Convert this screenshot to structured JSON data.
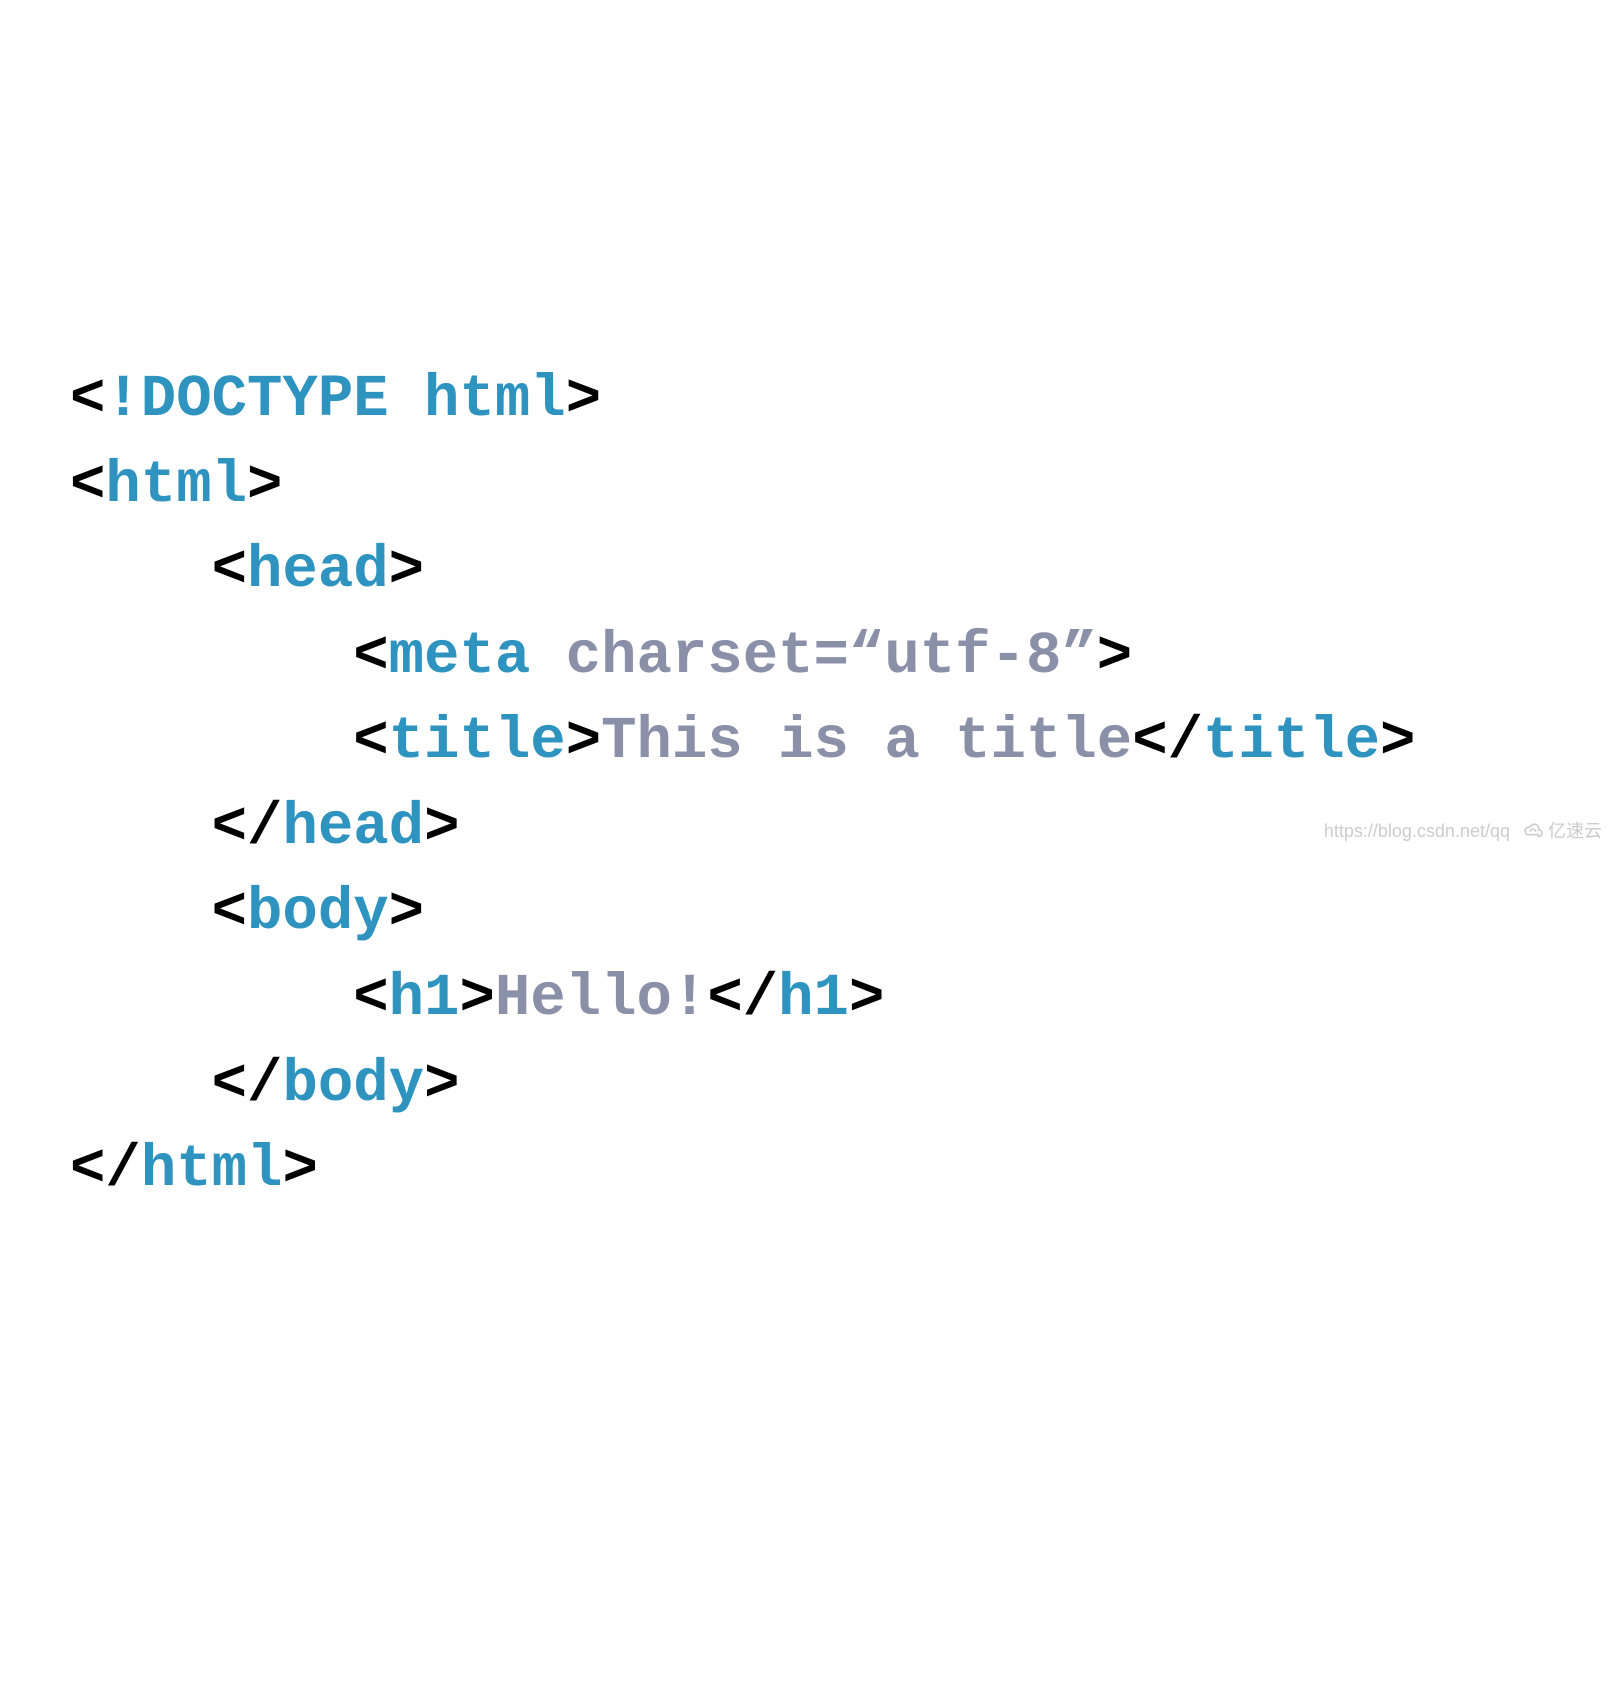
{
  "code": {
    "lines": [
      {
        "indent": 0,
        "tokens": [
          {
            "type": "bracket",
            "text": "<"
          },
          {
            "type": "tag",
            "text": "!DOCTYPE html"
          },
          {
            "type": "bracket",
            "text": ">"
          }
        ]
      },
      {
        "indent": 0,
        "tokens": [
          {
            "type": "bracket",
            "text": "<"
          },
          {
            "type": "tag",
            "text": "html"
          },
          {
            "type": "bracket",
            "text": ">"
          }
        ]
      },
      {
        "indent": 1,
        "tokens": [
          {
            "type": "bracket",
            "text": "<"
          },
          {
            "type": "tag",
            "text": "head"
          },
          {
            "type": "bracket",
            "text": ">"
          }
        ]
      },
      {
        "indent": 2,
        "tokens": [
          {
            "type": "bracket",
            "text": "<"
          },
          {
            "type": "tag",
            "text": "meta"
          },
          {
            "type": "attr",
            "text": " charset=“utf-8”"
          },
          {
            "type": "bracket",
            "text": ">"
          }
        ]
      },
      {
        "indent": 2,
        "tokens": [
          {
            "type": "bracket",
            "text": "<"
          },
          {
            "type": "tag",
            "text": "title"
          },
          {
            "type": "bracket",
            "text": ">"
          },
          {
            "type": "text",
            "text": "This is a title"
          },
          {
            "type": "bracket",
            "text": "</"
          },
          {
            "type": "tag",
            "text": "title"
          },
          {
            "type": "bracket",
            "text": ">"
          }
        ]
      },
      {
        "indent": 1,
        "tokens": [
          {
            "type": "bracket",
            "text": "</"
          },
          {
            "type": "tag",
            "text": "head"
          },
          {
            "type": "bracket",
            "text": ">"
          }
        ]
      },
      {
        "indent": 1,
        "tokens": [
          {
            "type": "bracket",
            "text": "<"
          },
          {
            "type": "tag",
            "text": "body"
          },
          {
            "type": "bracket",
            "text": ">"
          }
        ]
      },
      {
        "indent": 2,
        "tokens": [
          {
            "type": "bracket",
            "text": "<"
          },
          {
            "type": "tag",
            "text": "h1"
          },
          {
            "type": "bracket",
            "text": ">"
          },
          {
            "type": "text",
            "text": "Hello!"
          },
          {
            "type": "bracket",
            "text": "</"
          },
          {
            "type": "tag",
            "text": "h1"
          },
          {
            "type": "bracket",
            "text": ">"
          }
        ]
      },
      {
        "indent": 1,
        "tokens": [
          {
            "type": "bracket",
            "text": "</"
          },
          {
            "type": "tag",
            "text": "body"
          },
          {
            "type": "bracket",
            "text": ">"
          }
        ]
      },
      {
        "indent": 0,
        "tokens": [
          {
            "type": "bracket",
            "text": "</"
          },
          {
            "type": "tag",
            "text": "html"
          },
          {
            "type": "bracket",
            "text": ">"
          }
        ]
      }
    ]
  },
  "watermark": {
    "url": "https://blog.csdn.net/qq",
    "brand": "亿速云"
  }
}
